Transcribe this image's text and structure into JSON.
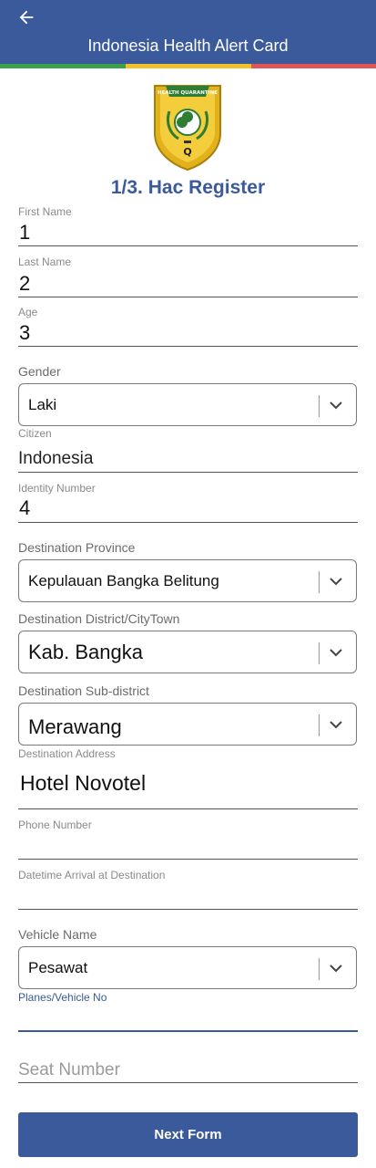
{
  "header": {
    "title": "Indonesia Health Alert Card"
  },
  "logo": {
    "text": "HEALTH QUARANTINE",
    "letter": "Q"
  },
  "form": {
    "title": "1/3. Hac Register",
    "first_name": {
      "label": "First Name",
      "value": "1"
    },
    "last_name": {
      "label": "Last Name",
      "value": "2"
    },
    "age": {
      "label": "Age",
      "value": "3"
    },
    "gender": {
      "label": "Gender",
      "value": "Laki"
    },
    "citizen": {
      "label": "Citizen",
      "value": "Indonesia"
    },
    "identity_number": {
      "label": "Identity Number",
      "value": "4"
    },
    "destination_province": {
      "label": "Destination Province",
      "value": "Kepulauan Bangka Belitung"
    },
    "destination_district": {
      "label": "Destination District/CityTown",
      "value": "Kab. Bangka"
    },
    "destination_subdistrict": {
      "label": "Destination Sub-district",
      "value": "Merawang"
    },
    "destination_address": {
      "label": "Destination Address",
      "value": "Hotel Novotel"
    },
    "phone_number": {
      "label": "Phone Number",
      "value": ""
    },
    "datetime_arrival": {
      "label": "Datetime Arrival at Destination",
      "value": ""
    },
    "vehicle_name": {
      "label": "Vehicle Name",
      "value": "Pesawat"
    },
    "vehicle_no": {
      "label": "Planes/Vehicle No",
      "value": ""
    },
    "seat_number": {
      "placeholder": "Seat Number"
    },
    "next_button": "Next Form"
  },
  "colors": {
    "primary": "#3a5a9c",
    "green": "#3aa14a",
    "yellow": "#f2c12e",
    "red": "#e05656"
  }
}
